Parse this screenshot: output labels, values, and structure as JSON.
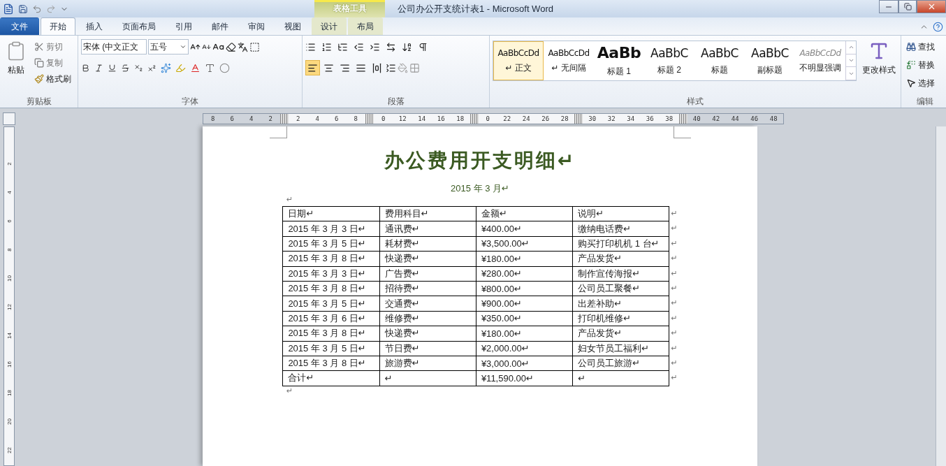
{
  "window": {
    "title": "公司办公开支统计表1 - Microsoft Word",
    "contextual_group": "表格工具"
  },
  "tabs": [
    {
      "label": "文件",
      "kind": "file",
      "selected": false
    },
    {
      "label": "开始",
      "kind": "normal",
      "selected": true
    },
    {
      "label": "插入",
      "kind": "normal",
      "selected": false
    },
    {
      "label": "页面布局",
      "kind": "normal",
      "selected": false
    },
    {
      "label": "引用",
      "kind": "normal",
      "selected": false
    },
    {
      "label": "邮件",
      "kind": "normal",
      "selected": false
    },
    {
      "label": "审阅",
      "kind": "normal",
      "selected": false
    },
    {
      "label": "视图",
      "kind": "normal",
      "selected": false
    },
    {
      "label": "设计",
      "kind": "contextual",
      "selected": false
    },
    {
      "label": "布局",
      "kind": "contextual",
      "selected": false
    }
  ],
  "ribbon": {
    "clipboard": {
      "label": "剪贴板",
      "paste": "粘贴",
      "cut": "剪切",
      "copy": "复制",
      "format_painter": "格式刷"
    },
    "font": {
      "label": "字体",
      "font_name": "宋体 (中文正文",
      "font_size": "五号"
    },
    "paragraph": {
      "label": "段落",
      "alignment": [
        {
          "kind": "left",
          "selected": true
        },
        {
          "kind": "center",
          "selected": false
        },
        {
          "kind": "right",
          "selected": false
        },
        {
          "kind": "justify",
          "selected": false
        },
        {
          "kind": "distribute",
          "selected": false
        }
      ]
    },
    "styles": {
      "label": "样式",
      "change_styles": "更改样式",
      "items": [
        {
          "preview": "AaBbCcDd",
          "name": "↵ 正文",
          "kind": "normal",
          "selected": true
        },
        {
          "preview": "AaBbCcDd",
          "name": "↵ 无间隔",
          "kind": "normal",
          "selected": false
        },
        {
          "preview": "AaBb",
          "name": "标题 1",
          "kind": "heading1",
          "selected": false
        },
        {
          "preview": "AaBbC",
          "name": "标题 2",
          "kind": "heading2",
          "selected": false
        },
        {
          "preview": "AaBbC",
          "name": "标题",
          "kind": "title",
          "selected": false
        },
        {
          "preview": "AaBbC",
          "name": "副标题",
          "kind": "subtitle",
          "selected": false
        },
        {
          "preview": "AaBbCcDd",
          "name": "不明显强调",
          "kind": "emphasis",
          "selected": false
        }
      ]
    },
    "editing": {
      "label": "编辑",
      "find": "查找",
      "replace": "替换",
      "select": "选择"
    }
  },
  "ruler": {
    "segments": [
      {
        "kind": "margin",
        "ticks": [
          "8",
          "6",
          "4",
          "2"
        ]
      },
      {
        "kind": "column",
        "ticks": [
          "2",
          "4",
          "6",
          "8"
        ]
      },
      {
        "kind": "column",
        "ticks": [
          "0",
          "12",
          "14",
          "16",
          "18"
        ]
      },
      {
        "kind": "column",
        "ticks": [
          "0",
          "22",
          "24",
          "26",
          "28"
        ]
      },
      {
        "kind": "column",
        "ticks": [
          "30",
          "32",
          "34",
          "36",
          "38"
        ]
      },
      {
        "kind": "margin",
        "ticks": [
          "40",
          "42",
          "44",
          "46",
          "48"
        ]
      }
    ],
    "vertical_ticks": [
      "2",
      "4",
      "6",
      "8",
      "10",
      "12",
      "14",
      "16",
      "18",
      "20",
      "22"
    ]
  },
  "document": {
    "title": "办公费用开支明细↵",
    "subtitle": "2015 年 3 月↵",
    "before_table": "↵",
    "after_table": "↵",
    "table": {
      "columns": [
        "日期↵",
        "费用科目↵",
        "金额↵",
        "说明↵"
      ],
      "rows": [
        [
          "2015 年 3 月 3 日↵",
          "通讯费↵",
          "¥400.00↵",
          "缴纳电话费↵"
        ],
        [
          "2015 年 3 月 5 日↵",
          "耗材费↵",
          "¥3,500.00↵",
          "购买打印机机 1 台↵"
        ],
        [
          "2015 年 3 月 8 日↵",
          "快递费↵",
          "¥180.00↵",
          "产品发货↵"
        ],
        [
          "2015 年 3 月 3 日↵",
          "广告费↵",
          "¥280.00↵",
          "制作宣传海报↵"
        ],
        [
          "2015 年 3 月 8 日↵",
          "招待费↵",
          "¥800.00↵",
          "公司员工聚餐↵"
        ],
        [
          "2015 年 3 月 5 日↵",
          "交通费↵",
          "¥900.00↵",
          "出差补助↵"
        ],
        [
          "2015 年 3 月 6 日↵",
          "维修费↵",
          "¥350.00↵",
          "打印机维修↵"
        ],
        [
          "2015 年 3 月 8 日↵",
          "快递费↵",
          "¥180.00↵",
          "产品发货↵"
        ],
        [
          "2015 年 3 月 5 日↵",
          "节日费↵",
          "¥2,000.00↵",
          "妇女节员工福利↵"
        ],
        [
          "2015 年 3 月 8 日↵",
          "旅游费↵",
          "¥3,000.00↵",
          "公司员工旅游↵"
        ],
        [
          "合计↵",
          "↵",
          "¥11,590.00↵",
          "↵"
        ]
      ],
      "row_end_marks": [
        "↵",
        "↵",
        "↵",
        "↵",
        "↵",
        "↵",
        "↵",
        "↵",
        "↵",
        "↵",
        "↵",
        "↵"
      ]
    }
  }
}
